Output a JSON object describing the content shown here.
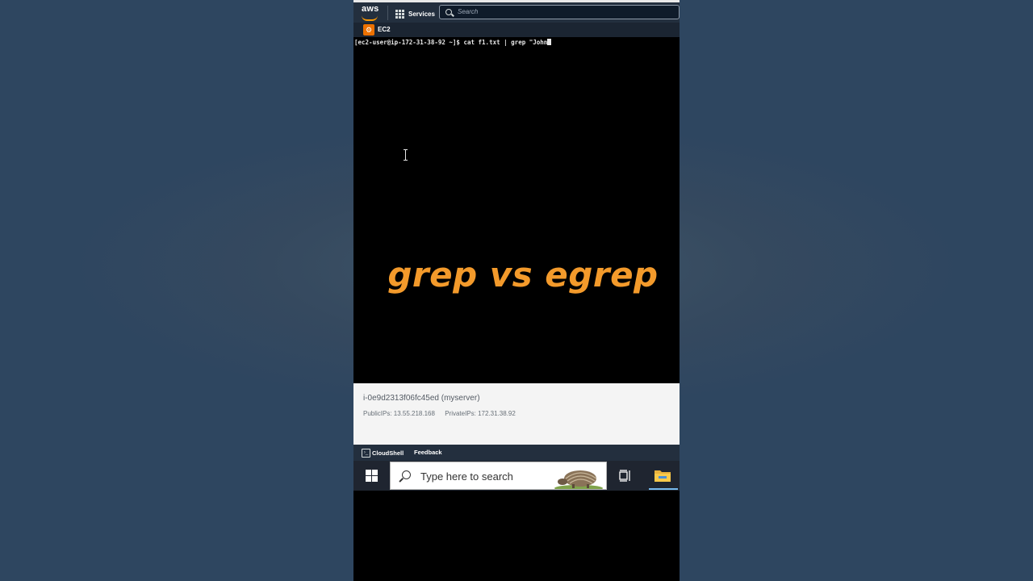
{
  "aws": {
    "logo_text": "aws",
    "services_label": "Services",
    "search_placeholder": "Search",
    "favorite_label": "EC2"
  },
  "terminal": {
    "prompt": "[ec2-user@ip-172-31-38-92 ~]$ ",
    "command": "cat f1.txt | grep \"John"
  },
  "overlay": {
    "title": "grep vs egrep"
  },
  "instance": {
    "id_line": "i-0e9d2313f06fc45ed (myserver)",
    "public_ips": "PublicIPs: 13.55.218.168",
    "private_ips": "PrivateIPs: 172.31.38.92"
  },
  "footer": {
    "cloudshell_label": "CloudShell",
    "feedback_label": "Feedback"
  },
  "taskbar": {
    "search_placeholder": "Type here to search"
  },
  "colors": {
    "background": "#2e4660",
    "overlay_text": "#f39a2b",
    "aws_orange": "#ff9900",
    "aws_nav": "#232f3e"
  },
  "icons": [
    "aws-logo",
    "grid-icon",
    "search-icon",
    "ec2-icon",
    "text-cursor-icon",
    "cloudshell-icon",
    "windows-start-icon",
    "search-icon",
    "task-view-icon",
    "file-explorer-icon"
  ]
}
